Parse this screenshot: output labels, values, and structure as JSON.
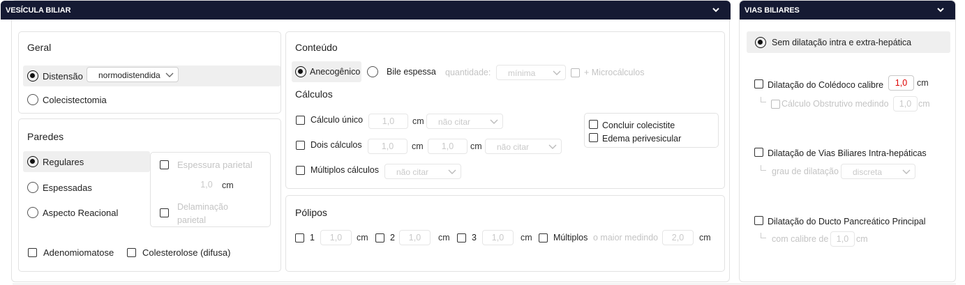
{
  "vesicula": {
    "title": "VESÍCULA BILIAR",
    "geral": {
      "heading": "Geral",
      "distensao_label": "Distensão",
      "distensao_value": "normodistendida",
      "colecistectomia_label": "Colecistectomia"
    },
    "paredes": {
      "heading": "Paredes",
      "regulares": "Regulares",
      "espessadas": "Espessadas",
      "aspecto_reacional": "Aspecto Reacional",
      "espessura_label": "Espessura parietal",
      "espessura_value": "1,0",
      "espessura_unit": "cm",
      "delaminacao_label_1": "Delaminação",
      "delaminacao_label_2": "parietal",
      "adenomiomatose": "Adenomiomatose",
      "colesterolose": "Colesterolose (difusa)"
    },
    "conteudo": {
      "heading": "Conteúdo",
      "anecogenico": "Anecogênico",
      "bile_espessa": "Bile espessa",
      "quantidade_label": "quantidade:",
      "quantidade_value": "mínima",
      "microcalculos": "+ Microcálculos",
      "calculos_heading": "Cálculos",
      "calculo_unico": "Cálculo único",
      "dois_calculos": "Dois cálculos",
      "multiplos_calculos": "Múltiplos cálculos",
      "size_value": "1,0",
      "unit": "cm",
      "nao_citar": "não citar",
      "concluir_colecistite": "Concluir colecistite",
      "edema_perivesicular": "Edema perivesicular"
    },
    "polipos": {
      "heading": "Pólipos",
      "opt1": "1",
      "opt2": "2",
      "opt3": "3",
      "size_value": "1,0",
      "unit": "cm",
      "multiplos": "Múltiplos",
      "maior_medindo": "o maior medindo",
      "maior_value": "2,0"
    }
  },
  "vias": {
    "title": "VIAS BILIARES",
    "sem_dilatacao": "Sem dilatação intra e extra-hepática",
    "coledoco_label": "Dilatação do Colédoco calibre",
    "coledoco_value": "1,0",
    "unit": "cm",
    "obstrutivo_label": "Cálculo Obstrutivo medindo",
    "obstrutivo_value": "1,0",
    "intra_label": "Dilatação de Vias Biliares Intra-hepáticas",
    "grau_label": "grau de dilatação",
    "grau_value": "discreta",
    "ducto_label": "Dilatação do Ducto Pancreático Principal",
    "calibre_label": "com calibre de",
    "calibre_value": "1,0"
  }
}
